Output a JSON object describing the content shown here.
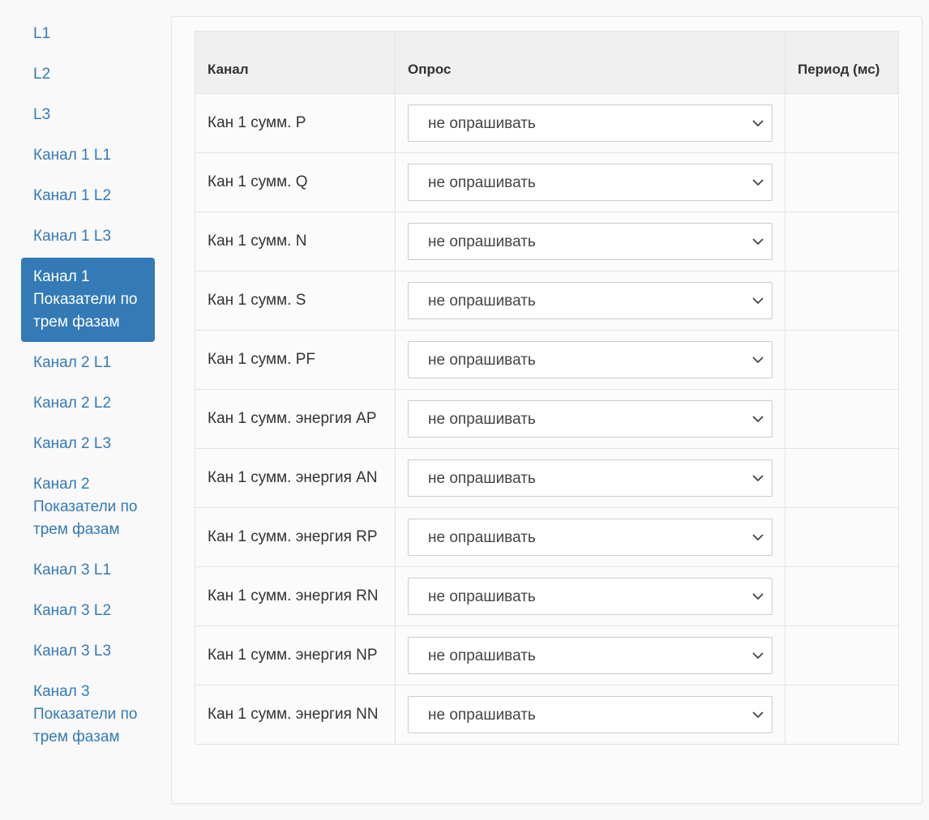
{
  "sidebar": {
    "items": [
      {
        "label": "L1"
      },
      {
        "label": "L2"
      },
      {
        "label": "L3"
      },
      {
        "label": "Канал 1 L1"
      },
      {
        "label": "Канал 1 L2"
      },
      {
        "label": "Канал 1 L3"
      },
      {
        "label": "Канал 1 Показатели по трем фазам",
        "active": true
      },
      {
        "label": "Канал 2 L1"
      },
      {
        "label": "Канал 2 L2"
      },
      {
        "label": "Канал 2 L3"
      },
      {
        "label": "Канал 2 Показатели по трем фазам"
      },
      {
        "label": "Канал 3 L1"
      },
      {
        "label": "Канал 3 L2"
      },
      {
        "label": "Канал 3 L3"
      },
      {
        "label": "Канал 3 Показатели по трем фазам"
      }
    ]
  },
  "table": {
    "headers": {
      "channel": "Канал",
      "poll": "Опрос",
      "period": "Период (мс)"
    },
    "rows": [
      {
        "channel": "Кан 1 сумм. P",
        "poll": "не опрашивать",
        "period": ""
      },
      {
        "channel": "Кан 1 сумм. Q",
        "poll": "не опрашивать",
        "period": ""
      },
      {
        "channel": "Кан 1 сумм. N",
        "poll": "не опрашивать",
        "period": ""
      },
      {
        "channel": "Кан 1 сумм. S",
        "poll": "не опрашивать",
        "period": ""
      },
      {
        "channel": "Кан 1 сумм. PF",
        "poll": "не опрашивать",
        "period": ""
      },
      {
        "channel": "Кан 1 сумм. энергия AP",
        "poll": "не опрашивать",
        "period": ""
      },
      {
        "channel": "Кан 1 сумм. энергия AN",
        "poll": "не опрашивать",
        "period": ""
      },
      {
        "channel": "Кан 1 сумм. энергия RP",
        "poll": "не опрашивать",
        "period": ""
      },
      {
        "channel": "Кан 1 сумм. энергия RN",
        "poll": "не опрашивать",
        "period": ""
      },
      {
        "channel": "Кан 1 сумм. энергия NP",
        "poll": "не опрашивать",
        "period": ""
      },
      {
        "channel": "Кан 1 сумм. энергия NN",
        "poll": "не опрашивать",
        "period": ""
      }
    ]
  },
  "colors": {
    "accent": "#337ab7",
    "header_bg": "#f0f0f0",
    "page_bg": "#f9f9f9"
  },
  "icons": {
    "select_arrow": "chevron-down-icon"
  }
}
